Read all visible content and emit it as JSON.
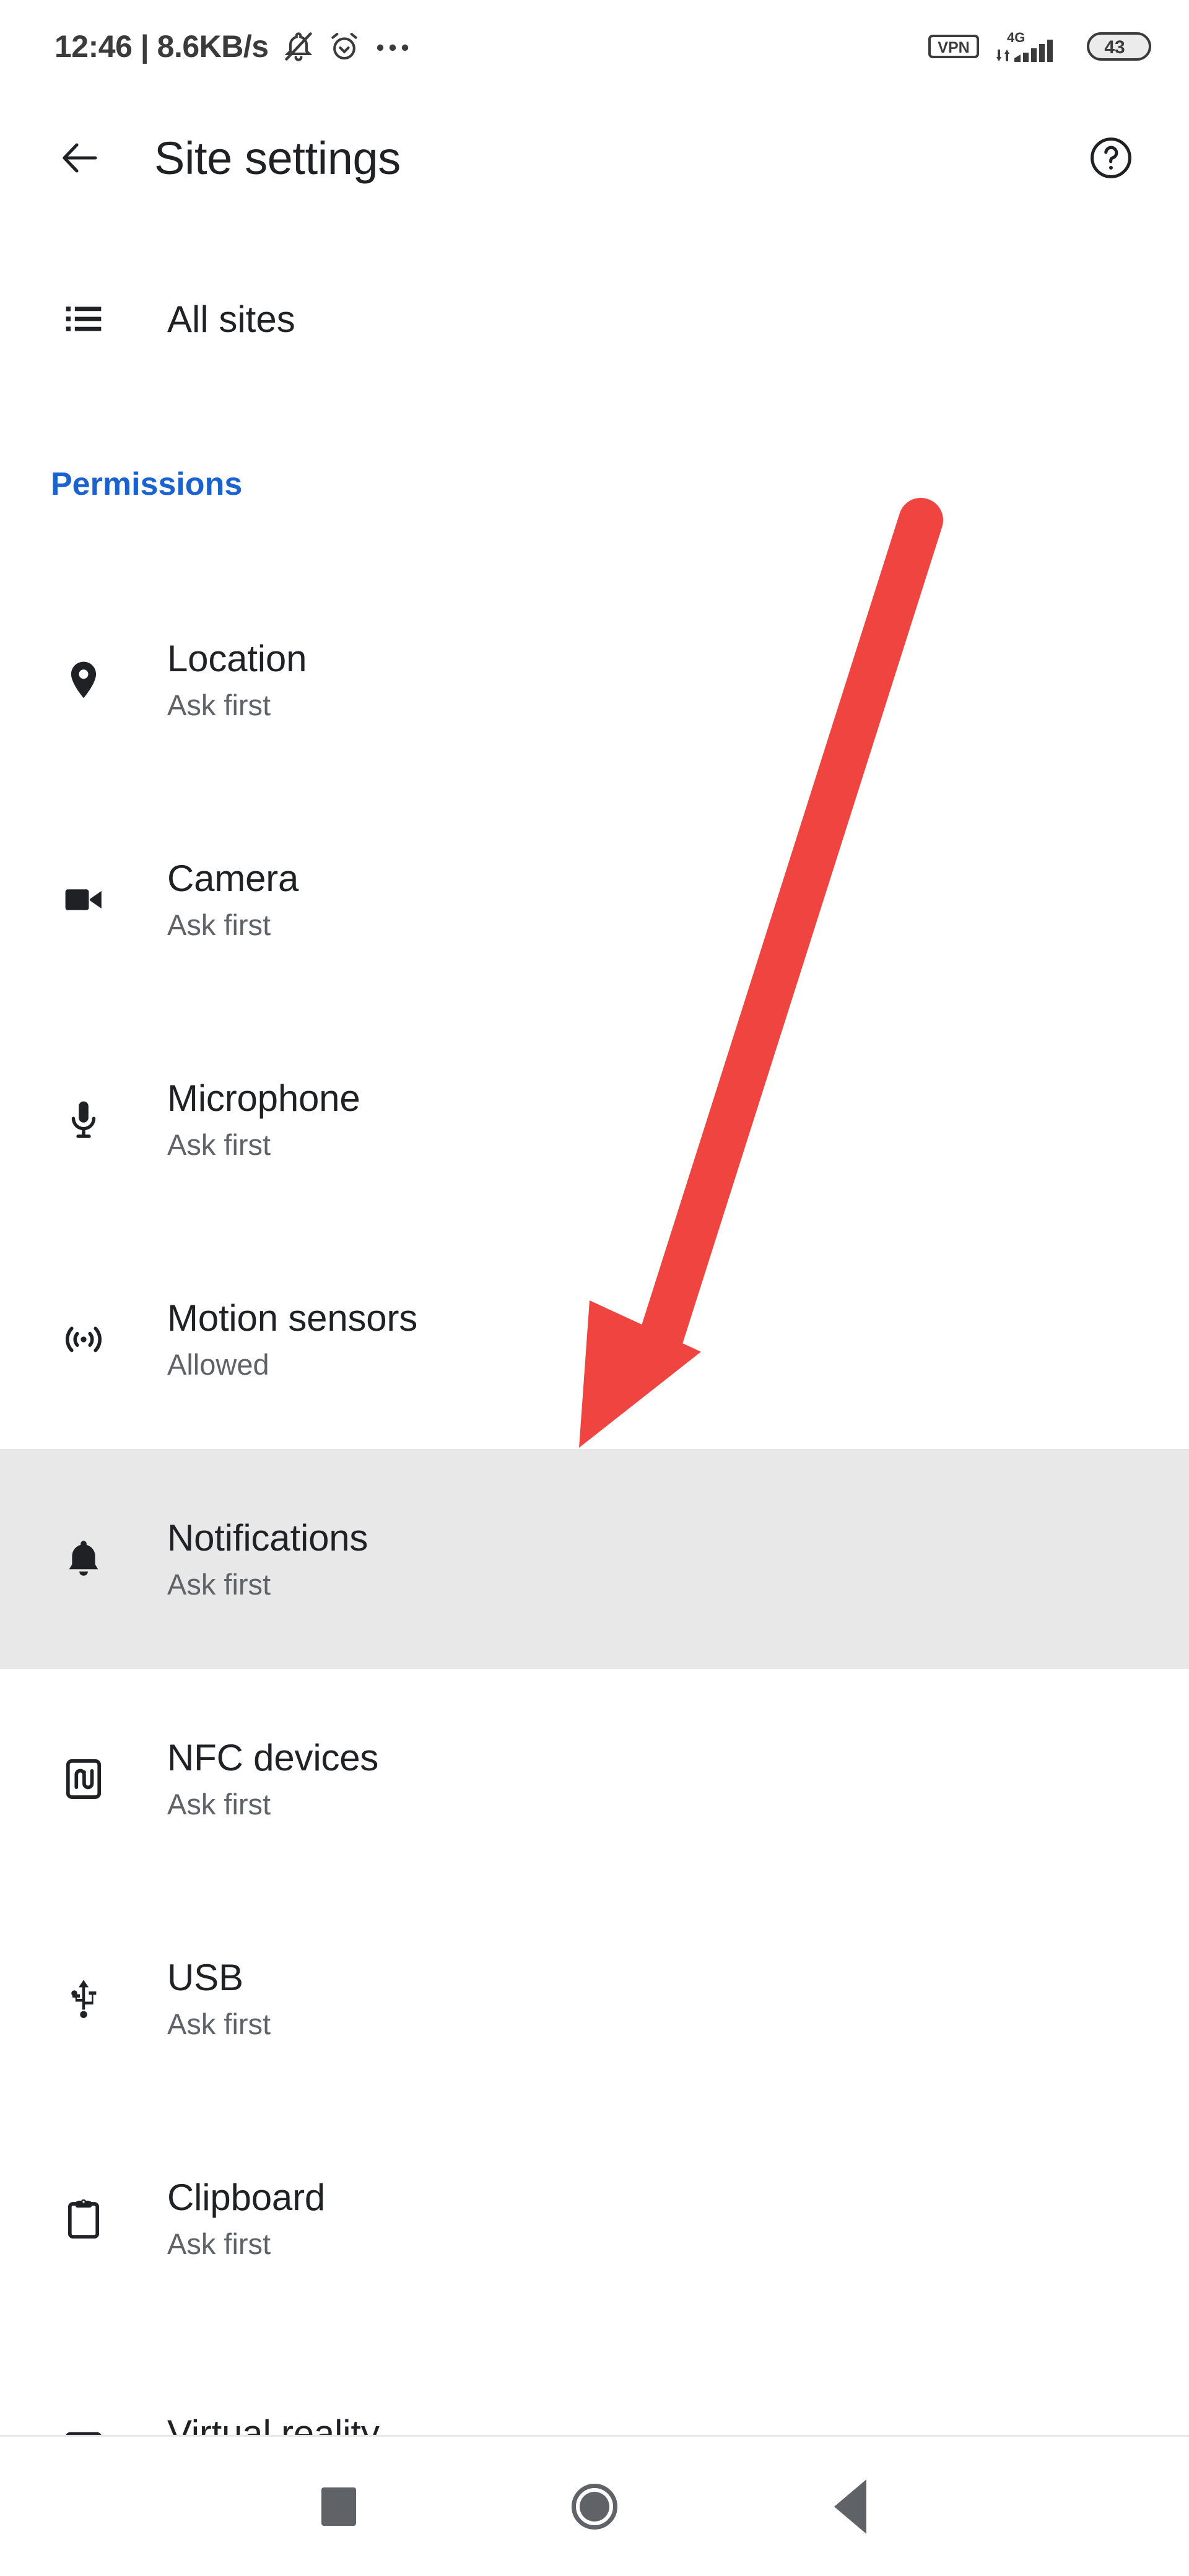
{
  "status_bar": {
    "clock": "12:46",
    "separator": "|",
    "network_speed": "8.6KB/s",
    "clock_text": "12:46 | 8.6KB/s",
    "icons_left": [
      "bell-muted-icon",
      "alarm-clock-icon",
      "more-dots-icon"
    ],
    "vpn_label": "VPN",
    "network_type": "4G",
    "battery_level": "43",
    "icons_right": [
      "vpn-badge",
      "mobile-data-arrows-icon",
      "signal-bars-icon",
      "battery-badge"
    ]
  },
  "header": {
    "back_icon": "back-arrow-icon",
    "title": "Site settings",
    "help_icon": "help-circle-icon"
  },
  "all_sites": {
    "icon": "list-icon",
    "label": "All sites"
  },
  "section": {
    "permissions_label": "Permissions",
    "accent_color": "#1a62cf"
  },
  "permissions": [
    {
      "icon": "location-pin-icon",
      "title": "Location",
      "status": "Ask first",
      "highlighted": false
    },
    {
      "icon": "video-camera-icon",
      "title": "Camera",
      "status": "Ask first",
      "highlighted": false
    },
    {
      "icon": "microphone-icon",
      "title": "Microphone",
      "status": "Ask first",
      "highlighted": false
    },
    {
      "icon": "motion-sensor-icon",
      "title": "Motion sensors",
      "status": "Allowed",
      "highlighted": false
    },
    {
      "icon": "bell-icon",
      "title": "Notifications",
      "status": "Ask first",
      "highlighted": true
    },
    {
      "icon": "nfc-icon",
      "title": "NFC devices",
      "status": "Ask first",
      "highlighted": false
    },
    {
      "icon": "usb-icon",
      "title": "USB",
      "status": "Ask first",
      "highlighted": false
    },
    {
      "icon": "clipboard-icon",
      "title": "Clipboard",
      "status": "Ask first",
      "highlighted": false
    },
    {
      "icon": "vr-headset-icon",
      "title": "Virtual reality",
      "status": "",
      "highlighted": false
    }
  ],
  "annotation": {
    "type": "arrow",
    "color": "#f04440",
    "points_to": "Notifications"
  },
  "nav_bar": {
    "recents": "recents-square-icon",
    "home": "home-circle-icon",
    "back": "back-triangle-icon"
  }
}
